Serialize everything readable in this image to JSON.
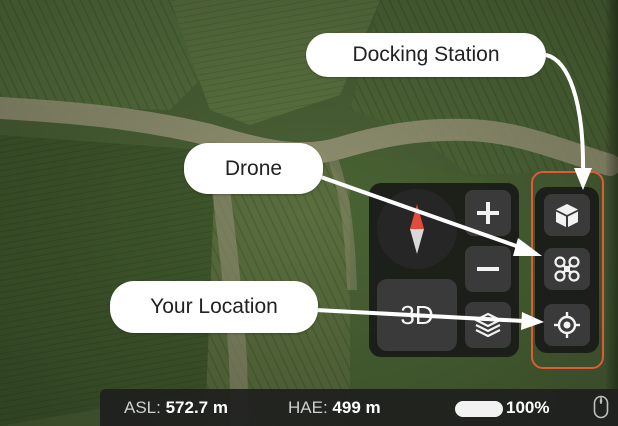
{
  "callouts": {
    "docking_station": "Docking Station",
    "drone": "Drone",
    "your_location": "Your Location"
  },
  "controls": {
    "view_3d_label": "3D",
    "zoom_in_label": "+",
    "zoom_out_label": "−",
    "icons": [
      "compass-icon",
      "layers-icon",
      "docking-station-icon",
      "drone-icon",
      "location-target-icon"
    ]
  },
  "status": {
    "asl_label": "ASL:",
    "asl_value": "572.7 m",
    "hae_label": "HAE:",
    "hae_value": "499 m",
    "battery_percent": "100%",
    "battery_level": 1.0
  },
  "colors": {
    "highlight": "#e05a37",
    "panel": "#161616",
    "button": "#3a3a3a",
    "compass_north": "#e34b3a"
  }
}
